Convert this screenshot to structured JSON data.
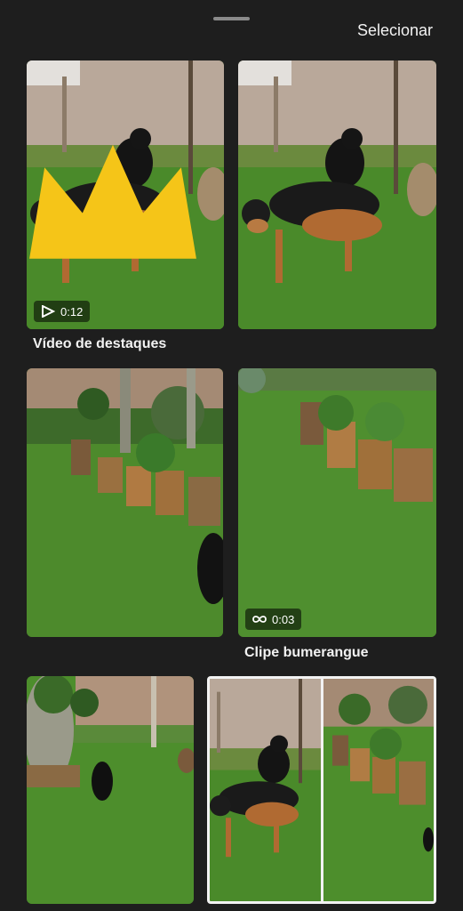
{
  "header": {
    "select_label": "Selecionar"
  },
  "highlights": {
    "caption": "Vídeo de destaques",
    "duration": "0:12",
    "duration_icon": "play-icon",
    "badge_icon": "crown-icon"
  },
  "boomerang": {
    "caption": "Clipe bumerangue",
    "duration": "0:03",
    "duration_icon": "infinity-icon"
  },
  "colors": {
    "background": "#1e1e1e",
    "text": "#f2f2f2",
    "crown": "#f5c518"
  }
}
